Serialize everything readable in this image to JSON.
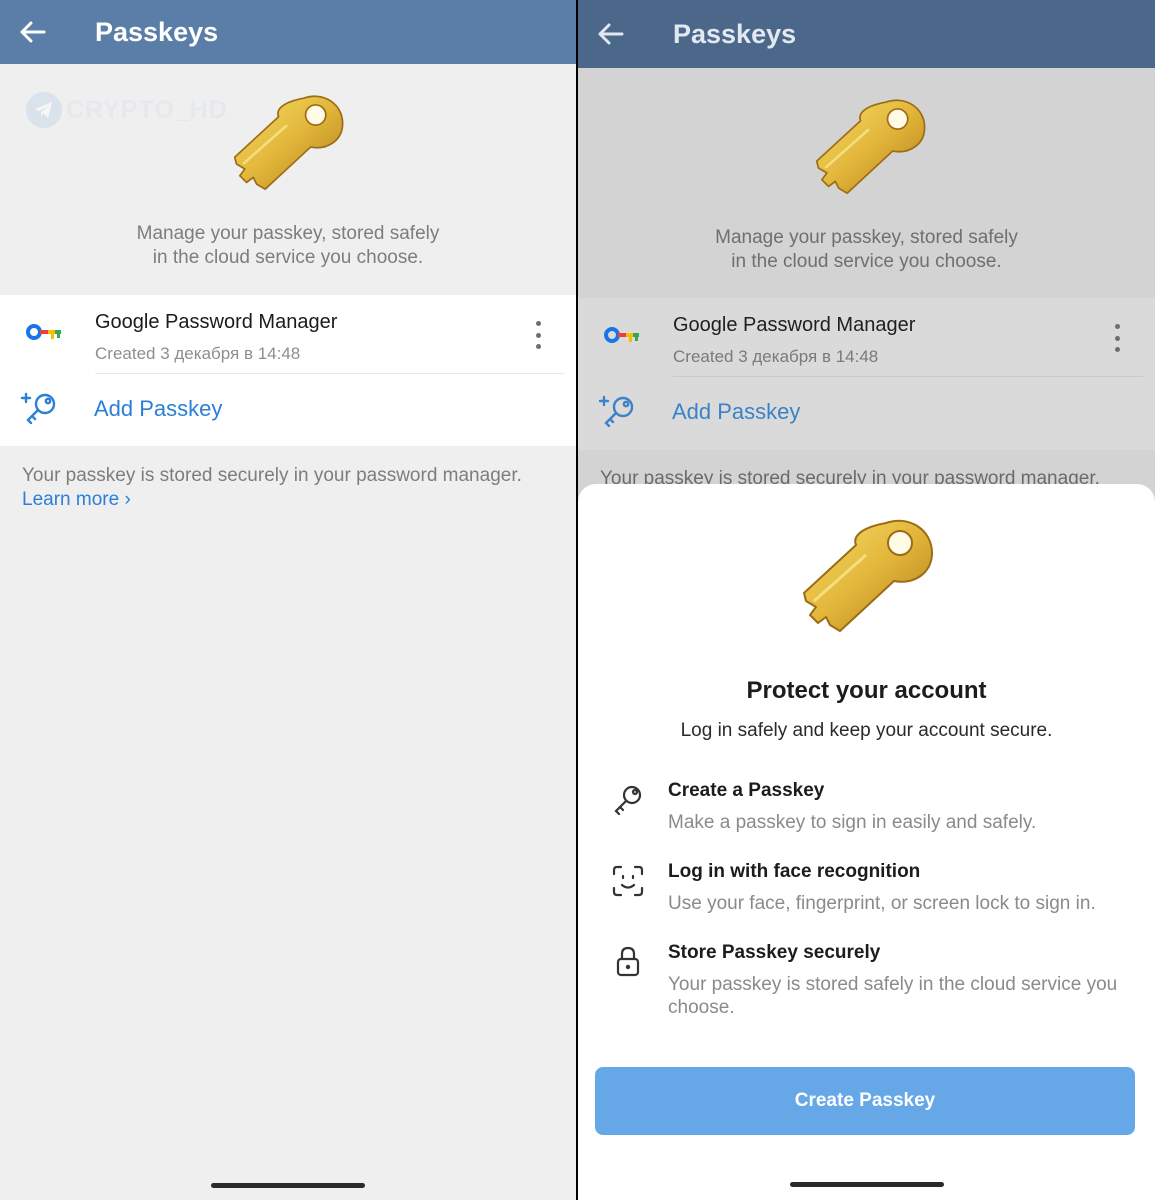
{
  "left": {
    "header": {
      "title": "Passkeys"
    },
    "watermark": "CRYPTO_HD",
    "intro": {
      "line1": "Manage your passkey, stored safely",
      "line2": "in the cloud service you choose."
    },
    "passkey": {
      "name": "Google Password Manager",
      "created": "Created 3 декабря в 14:48"
    },
    "add_label": "Add Passkey",
    "footer": {
      "note": "Your passkey is stored securely in your password manager.",
      "learn_more": "Learn more",
      "chevron": "›"
    }
  },
  "right": {
    "header": {
      "title": "Passkeys"
    },
    "intro": {
      "line1": "Manage your passkey, stored safely",
      "line2": "in the cloud service you choose."
    },
    "passkey": {
      "name": "Google Password Manager",
      "created": "Created 3 декабря в 14:48"
    },
    "add_label": "Add Passkey",
    "footer": {
      "note": "Your passkey is stored securely in your password manager."
    },
    "sheet": {
      "title": "Protect your account",
      "subtitle": "Log in safely and keep your account secure.",
      "features": [
        {
          "icon": "key-outline-icon",
          "title": "Create a Passkey",
          "desc": "Make a passkey to sign in easily and safely."
        },
        {
          "icon": "face-scan-icon",
          "title": "Log in with face recognition",
          "desc": "Use your face, fingerprint, or screen lock to sign in."
        },
        {
          "icon": "lock-icon",
          "title": "Store Passkey securely",
          "desc": "Your passkey is stored safely in the cloud service you choose."
        }
      ],
      "cta": "Create Passkey"
    }
  },
  "colors": {
    "accent": "#2b7fd6",
    "appbar": "#5b7ea8",
    "button": "#66a7e8",
    "key_gold": "#e2b63a"
  }
}
